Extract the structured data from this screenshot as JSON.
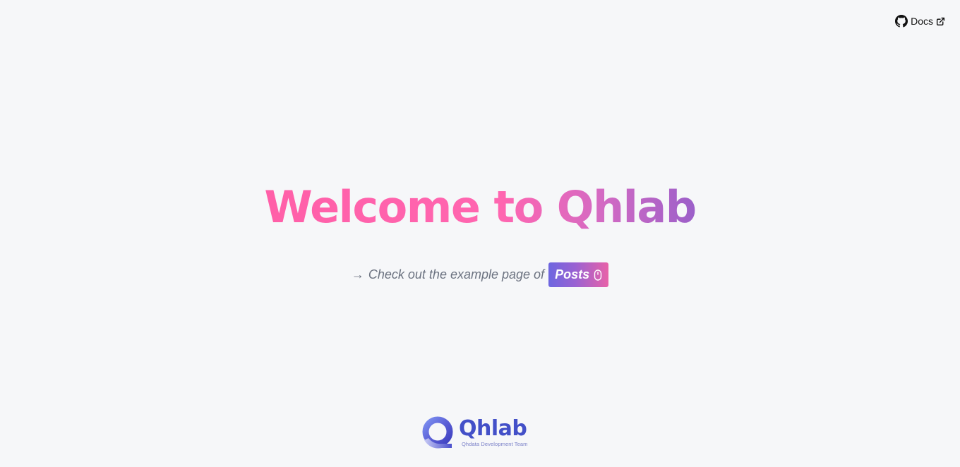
{
  "header": {
    "docs_label": "Docs",
    "github_icon": "github-icon",
    "external_icon": "external-link-icon"
  },
  "hero": {
    "title": "Welcome to Qhlab",
    "gradient_colors": [
      "#ff5fa8",
      "#ff66b0",
      "#d46ac3",
      "#9b5fc9"
    ]
  },
  "tagline": {
    "arrow": "→",
    "text": "Check out the example page of",
    "button_label": "Posts",
    "button_icon": "mouse-icon",
    "button_gradient": [
      "#6d66e0",
      "#9a62d2",
      "#e862a8"
    ]
  },
  "footer": {
    "logo_name": "Qhlab",
    "logo_subtitle": "Qhdata Development Team",
    "logo_color": "#4350c8"
  },
  "colors": {
    "background": "#f6f7f9",
    "muted_text": "#6b7280"
  }
}
